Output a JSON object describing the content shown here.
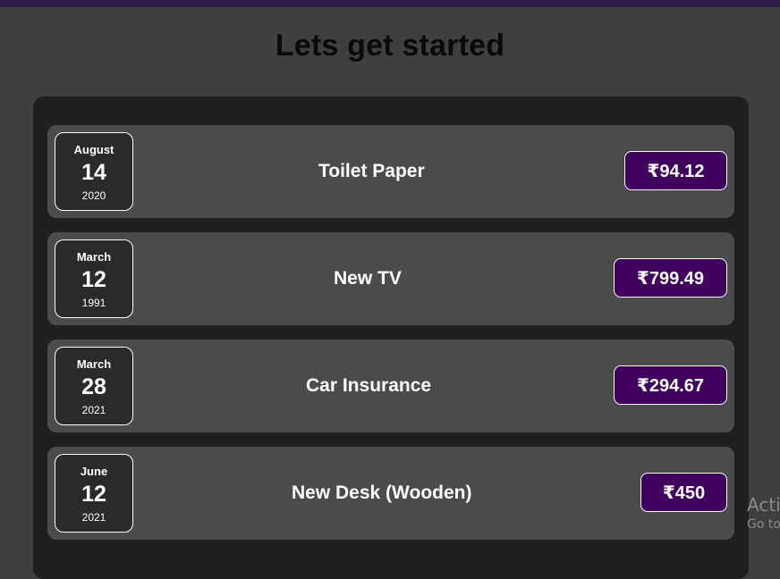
{
  "page": {
    "title": "Lets get started"
  },
  "expenses": [
    {
      "month": "August",
      "day": "14",
      "year": "2020",
      "title": "Toilet Paper",
      "amount": "₹94.12"
    },
    {
      "month": "March",
      "day": "12",
      "year": "1991",
      "title": "New TV",
      "amount": "₹799.49"
    },
    {
      "month": "March",
      "day": "28",
      "year": "2021",
      "title": "Car Insurance",
      "amount": "₹294.67"
    },
    {
      "month": "June",
      "day": "12",
      "year": "2021",
      "title": "New Desk (Wooden)",
      "amount": "₹450"
    }
  ],
  "watermark": {
    "line1": "Activ",
    "line2": "Go to"
  },
  "colors": {
    "page_background": "#3f3f3f",
    "panel_background": "#1f1f1f",
    "item_background": "#4b4b4b",
    "price_background": "#40005d",
    "top_bar": "#2b1c4a"
  }
}
